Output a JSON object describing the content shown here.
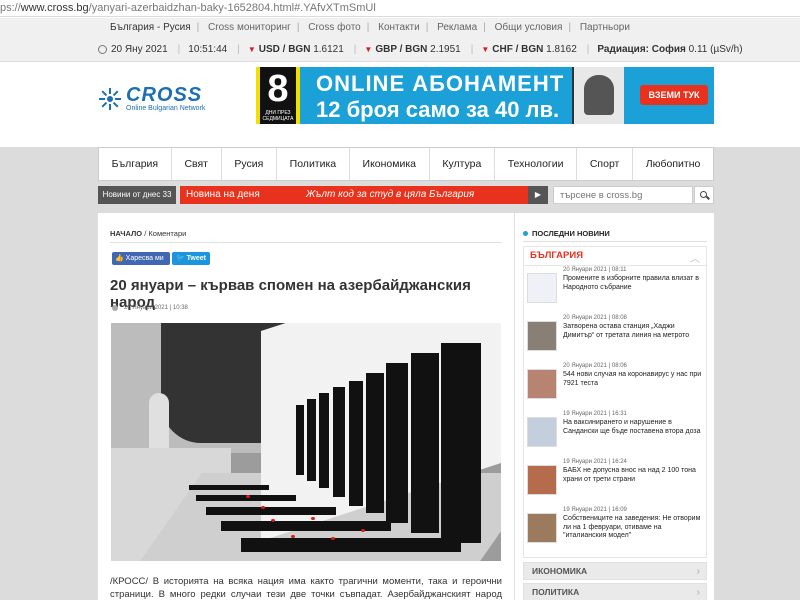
{
  "browser": {
    "url_prefix": "ps://",
    "url_host": "www.cross.bg",
    "url_path": "/yanyari-azerbaidzhan-baky-1652804.html#.YAfvXTmSmUl"
  },
  "topbar": {
    "links": [
      "България - Русия",
      "Cross мониторинг",
      "Cross фото",
      "Контакти",
      "Реклама",
      "Общи условия",
      "Партньори"
    ],
    "date": "20 Яну 2021",
    "time": "10:51:44",
    "rates": [
      {
        "label": "USD / BGN",
        "value": "1.6121"
      },
      {
        "label": "GBP / BGN",
        "value": "2.1951"
      },
      {
        "label": "CHF / BGN",
        "value": "1.8162"
      }
    ],
    "radiation_label": "Радиация: София",
    "radiation_value": "0.11 (µSv/h)",
    "accent_red": "#d02020"
  },
  "logo": {
    "name": "CROSS",
    "tagline": "Online Bulgarian Network",
    "color": "#1d6fb3"
  },
  "banner": {
    "number": "8",
    "small": "ДНИ ПРЕЗ СЕДМИЦАТА",
    "line1": "ONLINE АБОНАМЕНТ",
    "line2": "12 броя само за 40 лв.",
    "cta": "ВЗЕМИ ТУК",
    "bg_color": "#1ca0d8"
  },
  "nav": {
    "items": [
      "България",
      "Свят",
      "Русия",
      "Политика",
      "Икономика",
      "Култура",
      "Технологии",
      "Спорт",
      "Любопитно"
    ]
  },
  "ticker": {
    "news_today": "Новини от днес 33",
    "label": "Новина на деня",
    "headline": "Жълт код за студ в цяла България",
    "color": "#e8321e"
  },
  "search": {
    "placeholder": "търсене в cross.bg"
  },
  "article": {
    "breadcrumb_home": "НАЧАЛО",
    "breadcrumb_section": "Коментари",
    "share_fb": "Харесва ми",
    "share_tw": "Tweet",
    "title": "20 януари – кървав спомен на азербайджанския народ",
    "meta": "20 Януари 2021 | 10:38",
    "body": "/КРОСС/ В историята на всяка нация има както трагични моменти, така и героични страници. В много редки случаи тези две точки съвпадат. Азербайджанският народ преживя Кървавия"
  },
  "sidebar": {
    "title": "ПОСЛЕДНИ НОВИНИ",
    "section": "БЪЛГАРИЯ",
    "items": [
      {
        "date": "20 Януари 2021 | 08:11",
        "title": "Промените в изборните правила влизат в Народното събрание"
      },
      {
        "date": "20 Януари 2021 | 08:08",
        "title": "Затворена остава станция „Хаджи Димитър“ от третата линия на метрото"
      },
      {
        "date": "20 Януари 2021 | 08:06",
        "title": "544 нови случая на коронавирус у нас при 7921 теста"
      },
      {
        "date": "19 Януари 2021 | 16:31",
        "title": "На ваксинирането и нарушение в Сандански ще бъде поставена втора доза"
      },
      {
        "date": "19 Януари 2021 | 16:24",
        "title": "БАБХ не допусна внос на над 2 100 тона храни от трети страни"
      },
      {
        "date": "19 Януари 2021 | 16:09",
        "title": "Собствениците на заведения: Не отворим ли на 1 февруари, отиваме на \"италианския модел\""
      }
    ],
    "categories": [
      "ИКОНОМИКА",
      "ПОЛИТИКА"
    ]
  }
}
